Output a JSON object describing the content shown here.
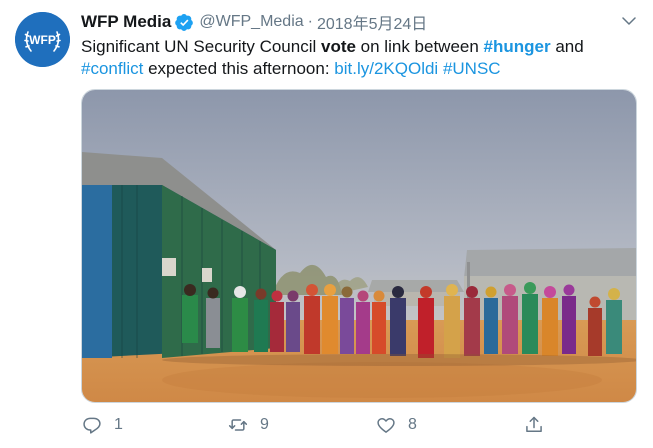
{
  "author": {
    "display_name": "WFP Media",
    "handle": "@WFP_Media",
    "separator": "·",
    "date": "2018年5月24日",
    "avatar_text": "WFP",
    "verified_icon": "verified-badge-icon"
  },
  "tweet": {
    "t1": "Significant UN Security Council ",
    "t2": "vote",
    "t3": " on link between ",
    "t4": "#hunger",
    "t5": " and",
    "t6": "#conflict",
    "t7": " expected this afternoon: ",
    "t8": "bit.ly/2KQOldi",
    "t9": " ",
    "t10": "#UNSC"
  },
  "media": {
    "description_icon": "photo-people-queue-outside-tin-buildings"
  },
  "actions": {
    "reply_count": "1",
    "retweet_count": "9",
    "like_count": "8",
    "share_count": ""
  },
  "colors": {
    "link": "#1b95e0",
    "secondary_text": "#657786",
    "avatar_bg": "#1f6fbd",
    "verified": "#1da1f2"
  }
}
